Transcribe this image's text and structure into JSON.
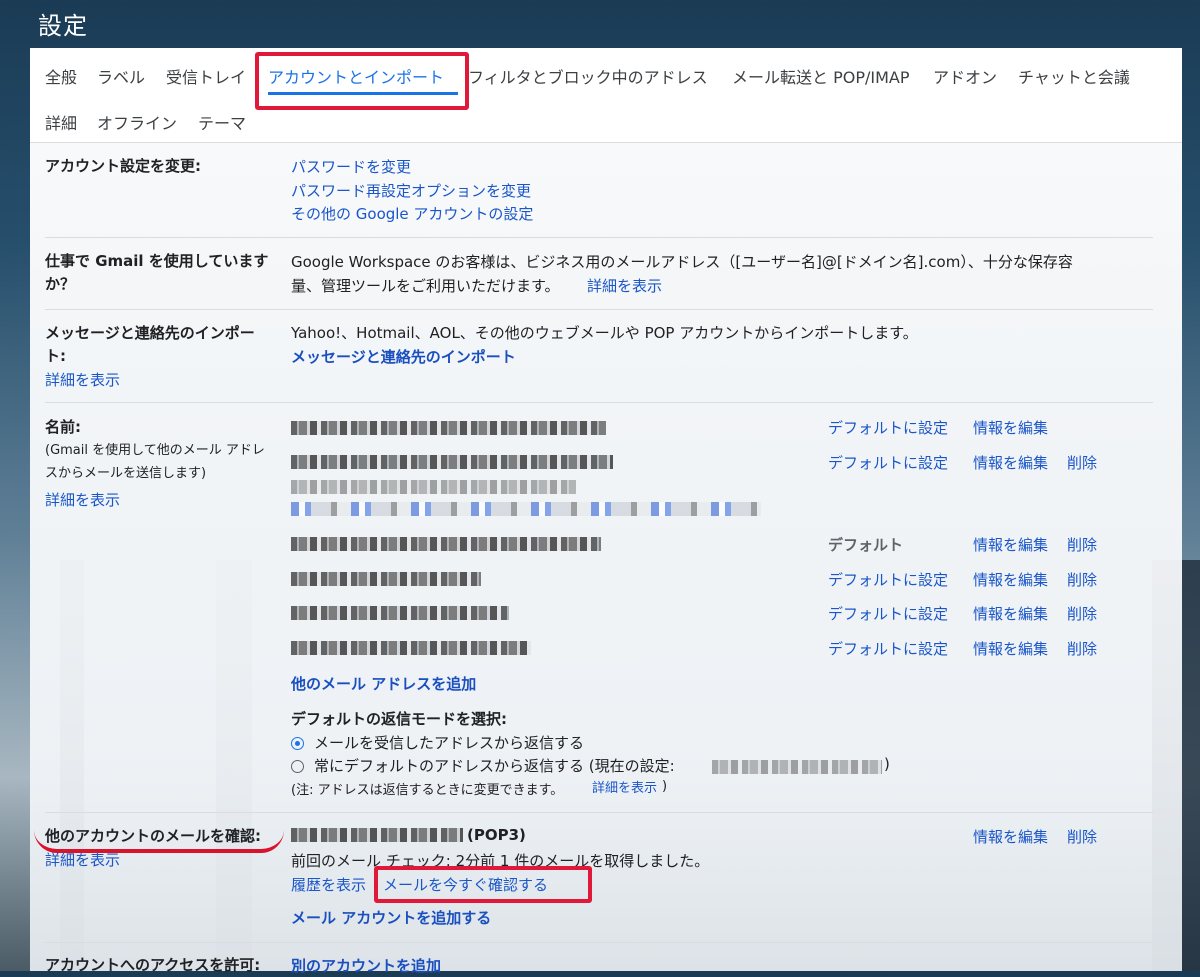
{
  "page_title": "設定",
  "tabs": [
    "全般",
    "ラベル",
    "受信トレイ",
    "アカウントとインポート",
    "フィルタとブロック中のアドレス",
    "メール転送と POP/IMAP",
    "アドオン",
    "チャットと会議",
    "詳細",
    "オフライン",
    "テーマ"
  ],
  "account_settings": {
    "label": "アカウント設定を変更:",
    "links": [
      "パスワードを変更",
      "パスワード再設定オプションを変更",
      "その他の Google アカウントの設定"
    ]
  },
  "workspace": {
    "label_line1": "仕事で Gmail を使用していますか？",
    "text_line1": "Google Workspace のお客様は、ビジネス用のメールアドレス（[ユーザー名]@[ドメイン名].com）、十分な保存容",
    "text_line2": "量、管理ツールをご利用いただけます。",
    "details_link": "詳細を表示"
  },
  "import": {
    "label_line1": "メッセージと連絡先のインポー",
    "label_line2": "ト:",
    "details_link": "詳細を表示",
    "text": "Yahoo!、Hotmail、AOL、その他のウェブメールや POP アカウントからインポートします。",
    "action_link": "メッセージと連絡先のインポート"
  },
  "name": {
    "label": "名前:",
    "sub_line1": "(Gmail を使用して他のメール アドレ",
    "sub_line2": "スからメールを送信します)",
    "details_link": "詳細を表示",
    "set_default": "デフォルトに設定",
    "default_label": "デフォルト",
    "edit_info": "情報を編集",
    "delete": "削除",
    "add_address": "他のメール アドレスを追加",
    "reply_mode_title": "デフォルトの返信モードを選択:",
    "reply_option1": "メールを受信したアドレスから返信する",
    "reply_option2": "常にデフォルトのアドレスから返信する (現在の設定:",
    "reply_option2_end": ")",
    "note": "(注: アドレスは返信するときに変更できます。",
    "note_link": "詳細を表示",
    "note_end": ")"
  },
  "check_mail": {
    "label": "他のアカウントのメールを確認:",
    "details_link": "詳細を表示",
    "account_suffix": "(POP3)",
    "edit_info": "情報を編集",
    "delete": "削除",
    "last_check": "前回のメール チェック: 2分前 1 件のメールを取得しました。",
    "history_link": "履歴を表示",
    "check_now_link": "メールを今すぐ確認する",
    "add_account": "メール アカウントを追加する"
  },
  "grant_access": {
    "label": "アカウントへのアクセスを許可:",
    "link": "別のアカウントを追加"
  }
}
